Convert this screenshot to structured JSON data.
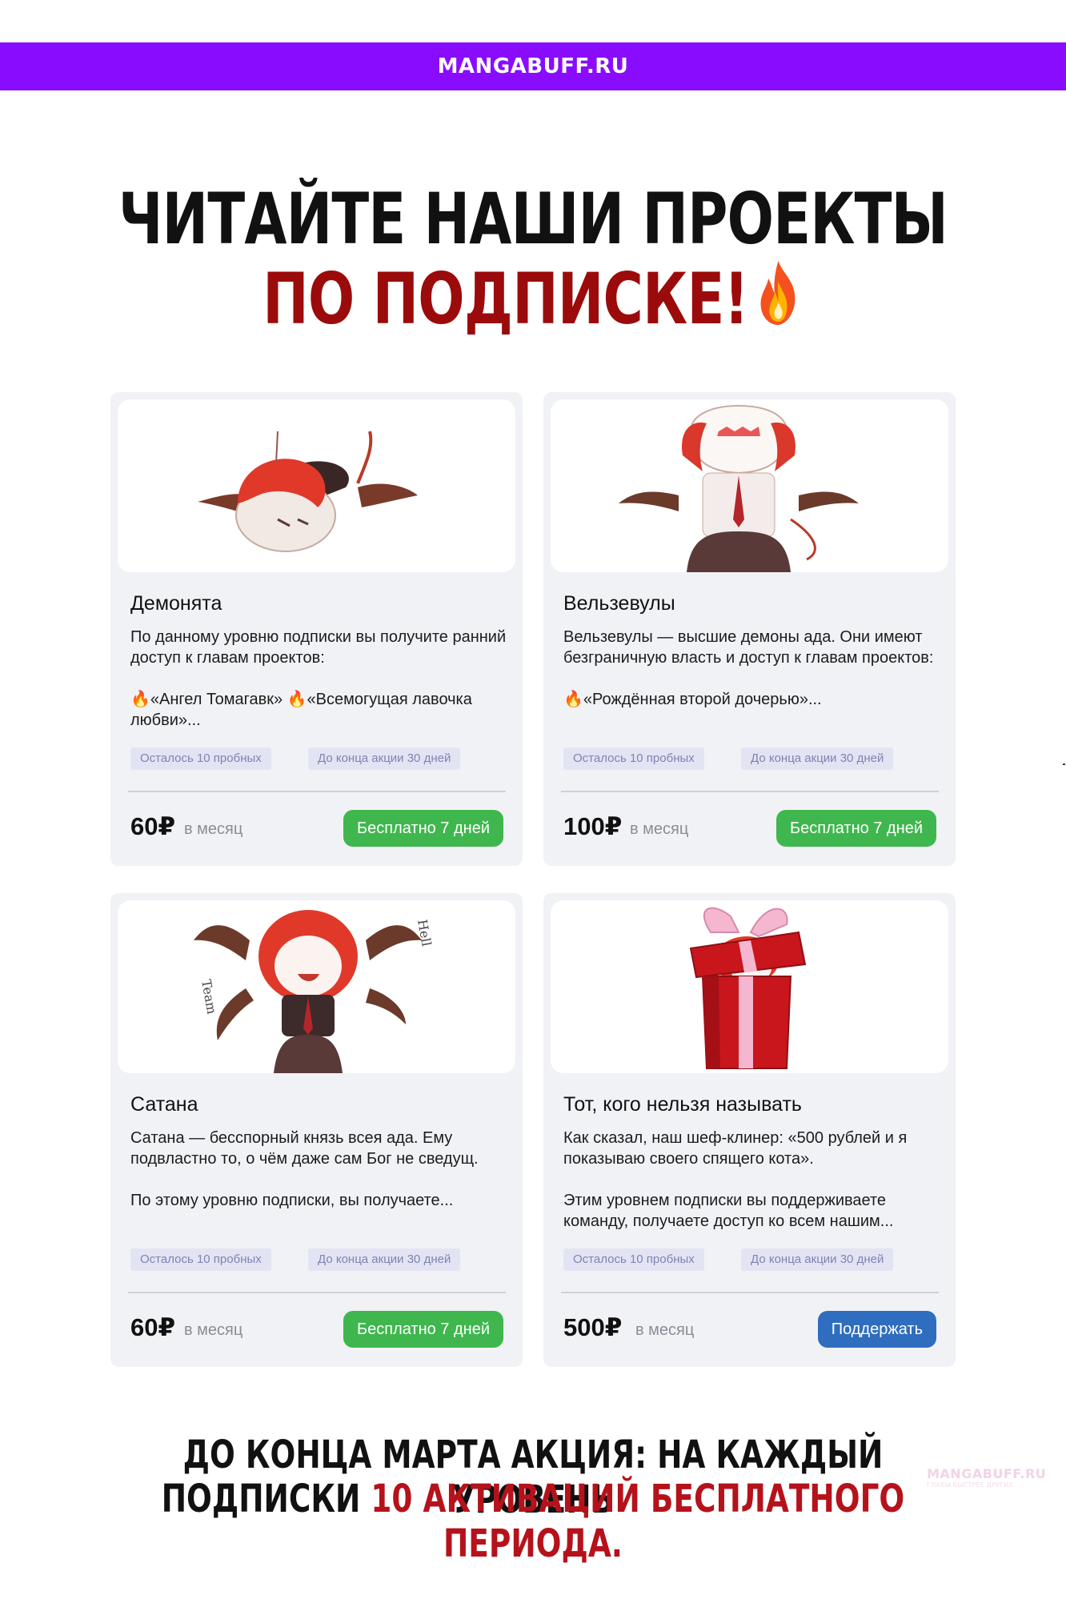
{
  "site": {
    "name": "MANGABUFF.RU"
  },
  "headline": {
    "line1": "ЧИТАЙТЕ НАШИ ПРОЕКТЫ",
    "line2": "ПО ПОДПИСКЕ!",
    "icon": "fire-icon"
  },
  "tiers": [
    {
      "title": "Демонята",
      "desc1": "По данному уровню подписки вы получите ранний доступ к главам проектов:",
      "desc2": "🔥«Ангел Томагавк» 🔥«Всемогущая лавочка любви»...",
      "chip1": "Осталось 10 пробных",
      "chip2": "До конца акции 30 дней",
      "price": "60₽",
      "per": "в месяц",
      "button": "Бесплатно 7 дней",
      "image": "chibi-demon-lying-illustration"
    },
    {
      "title": "Вельзевулы",
      "desc1": "Вельзевулы — высшие демоны ада. Они имеют безграничную власть и доступ к главам проектов:",
      "desc2": "🔥«Рождённая второй дочерью»...",
      "chip1": "Осталось 10 пробных",
      "chip2": "До конца акции 30 дней",
      "price": "100₽",
      "per": "в месяц",
      "button": "Бесплатно 7 дней",
      "image": "chibi-demon-shouting-illustration"
    },
    {
      "title": "Сатана",
      "desc1": "Сатана — бесспорный князь всея ада. Ему подвластно то, о чём даже сам Бог не сведущ.",
      "desc2": "По этому уровню подписки, вы получаете...",
      "chip1": "Осталось 10 пробных",
      "chip2": "До конца акции 30 дней",
      "price": "60₽",
      "per": "в месяц",
      "button": "Бесплатно 7 дней",
      "image": "chibi-demon-cheering-illustration",
      "image_text": {
        "left": "Team",
        "right": "Hell"
      }
    },
    {
      "title": "Тот, кого нельзя называть",
      "desc1": "Как сказал, наш шеф-клинер: «500 рублей и я показываю своего спящего кота».",
      "desc2": "Этим уровнем подписки вы поддерживаете команду, получаете доступ ко всем нашим...",
      "chip1": "Осталось 10 пробных",
      "chip2": "До конца акции 30 дней",
      "price": "500₽",
      "per": "в месяц",
      "button": "Поддержать",
      "image": "chibi-in-gift-box-illustration"
    }
  ],
  "promo": {
    "line1": "ДО КОНЦА МАРТА АКЦИЯ: НА КАЖДЫЙ УРОВЕНЬ",
    "line2_start": "ПОДПИСКИ ",
    "line2_accent": "10 АКТИВАЦИЙ БЕСПЛАТНОГО ПЕРИОДА."
  },
  "watermark": {
    "name": "MANGABUFF.RU",
    "tagline": "ГЛАВЫ БЫСТРЕЕ ДРУГИХ"
  },
  "colors": {
    "brand_bar": "#8a0cff",
    "headline_red": "#9b0b0b",
    "button_green": "#3fb74e",
    "button_blue": "#2f6dbf",
    "chip_bg": "#e3e4f3"
  }
}
